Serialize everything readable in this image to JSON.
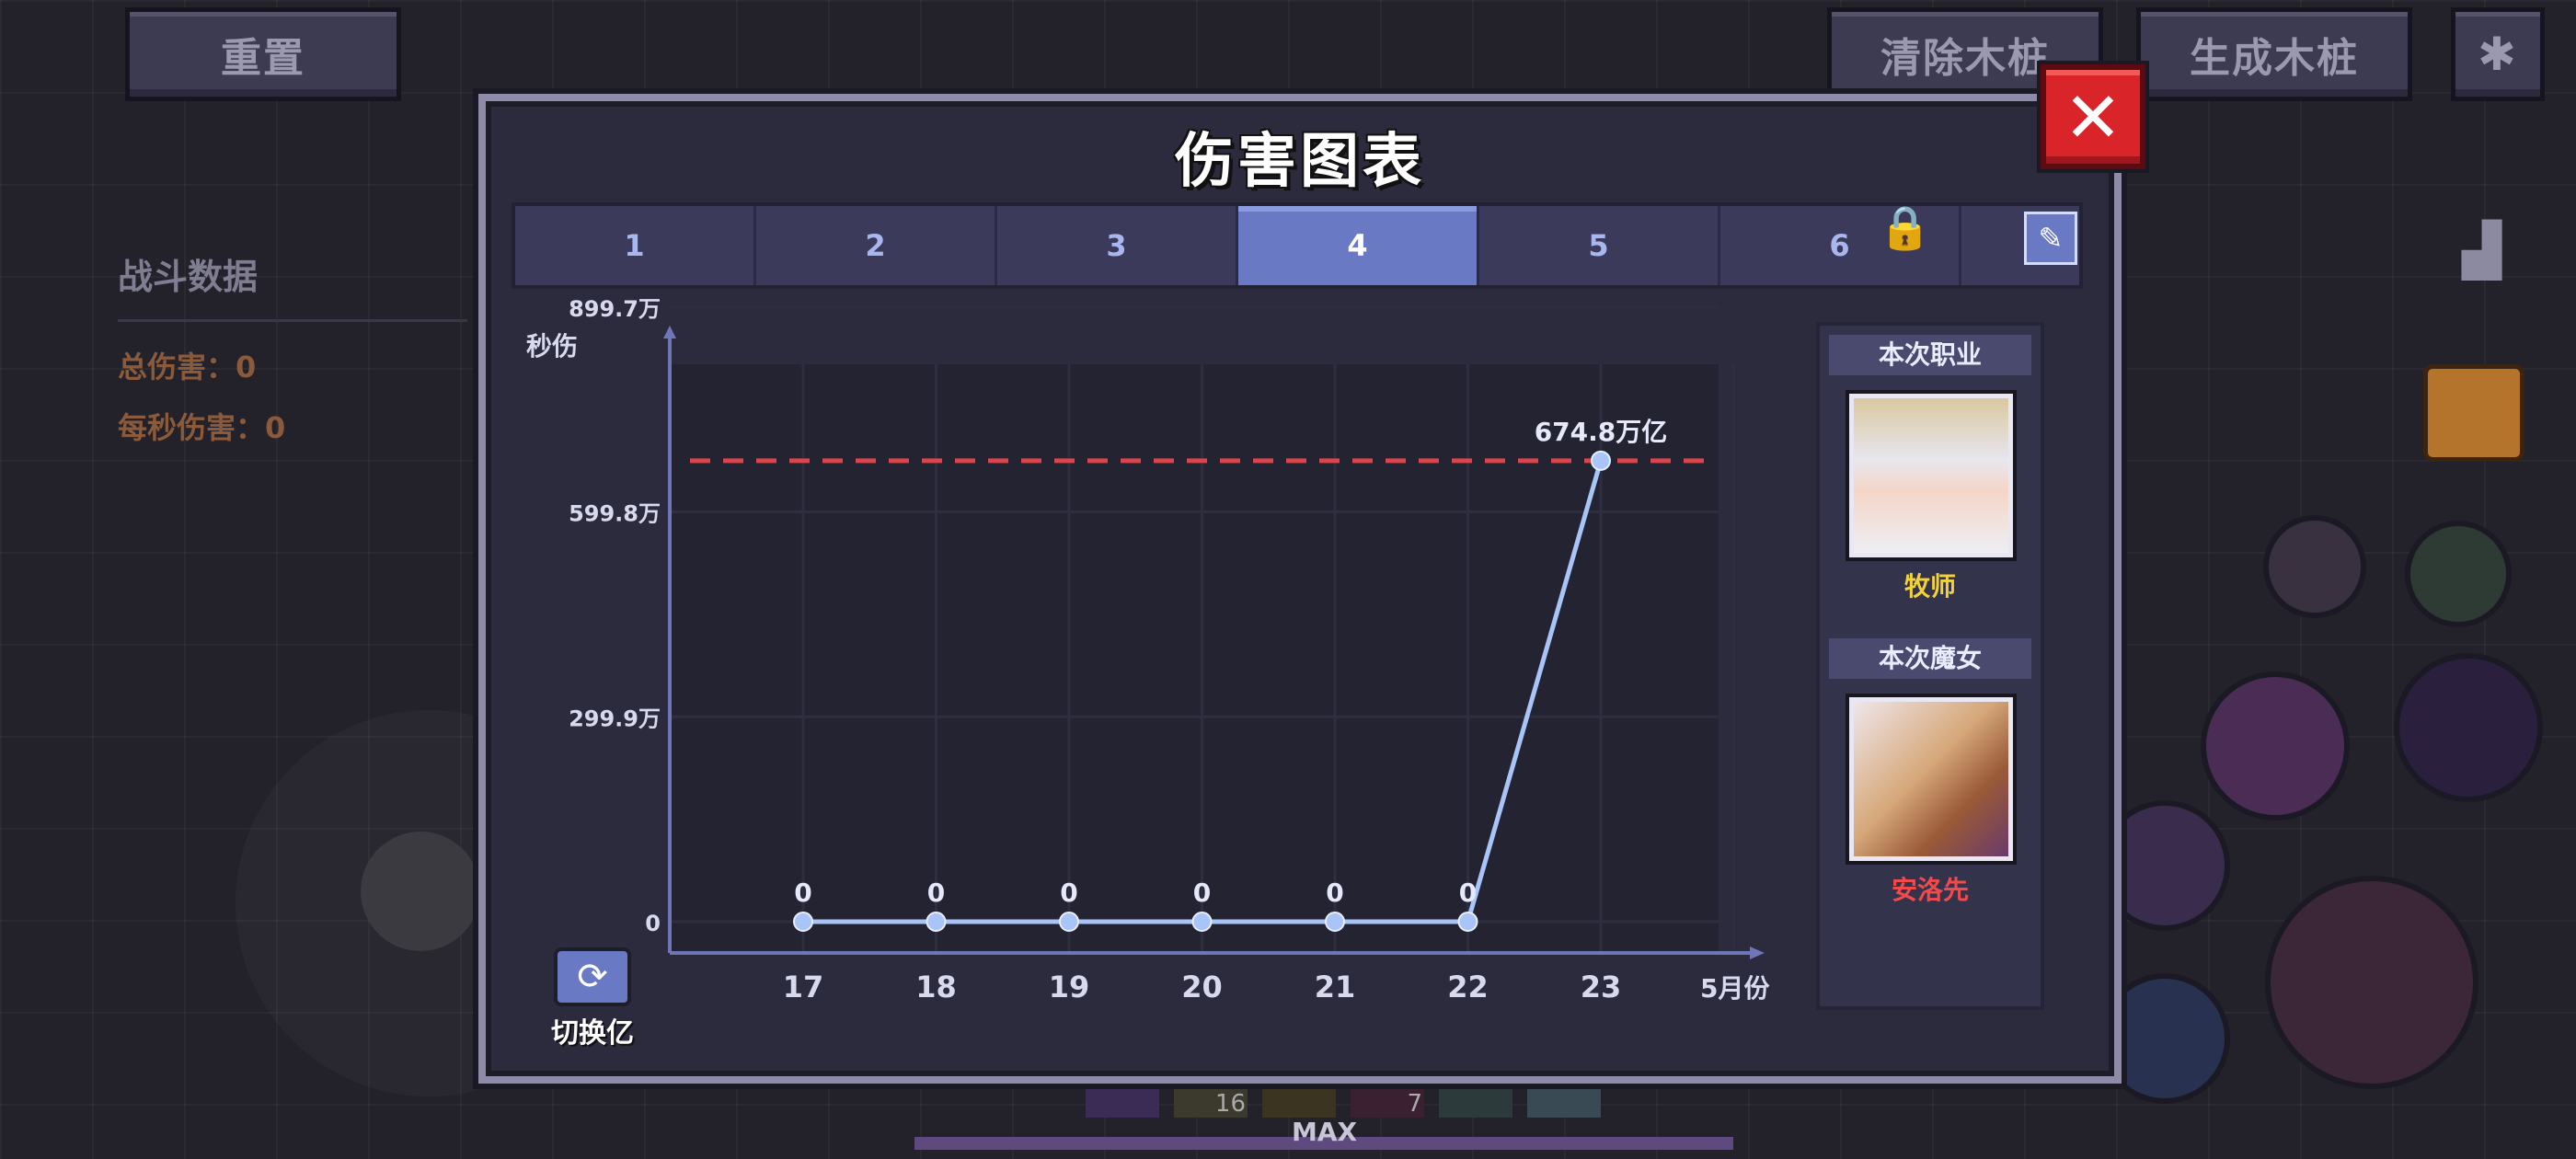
{
  "hud": {
    "reset_label": "重置",
    "clear_label": "清除木桩",
    "spawn_label": "生成木桩",
    "stats_title": "战斗数据",
    "total_damage": "总伤害：0",
    "dps": "每秒伤害：0",
    "max_label": "MAX",
    "slot_count_1": "16",
    "slot_count_2": "7"
  },
  "modal": {
    "title": "伤害图表",
    "close_symbol": "✕",
    "tabs": [
      {
        "label": "1",
        "active": false
      },
      {
        "label": "2",
        "active": false
      },
      {
        "label": "3",
        "active": false
      },
      {
        "label": "4",
        "active": true
      },
      {
        "label": "5",
        "active": false
      },
      {
        "label": "6",
        "active": false,
        "locked": true
      }
    ],
    "lock_icon": "lock-icon",
    "edit_icon": "pencil-icon",
    "switch_label": "切换亿",
    "class_label": "本次职业",
    "class_name": "牧师",
    "witch_label": "本次魔女",
    "witch_name": "安洛先",
    "colors": {
      "accent": "#6a79c4",
      "line": "#a9c4f7",
      "threshold": "#d9464c",
      "class_name": "#f2d23a",
      "witch_name": "#f24a4a"
    }
  },
  "chart_data": {
    "type": "line",
    "ylabel": "秒伤",
    "xlabel": "5月份",
    "categories": [
      "17",
      "18",
      "19",
      "20",
      "21",
      "22",
      "23"
    ],
    "series": [
      {
        "values": [
          0,
          0,
          0,
          0,
          0,
          0,
          674.8
        ]
      }
    ],
    "data_labels": [
      "0",
      "0",
      "0",
      "0",
      "0",
      "0",
      "674.8万亿"
    ],
    "y_ticks": [
      {
        "value": 0,
        "label": "0"
      },
      {
        "value": 299.9,
        "label": "299.9万"
      },
      {
        "value": 599.8,
        "label": "599.8万"
      },
      {
        "value": 899.7,
        "label": "899.7万"
      }
    ],
    "ylim": [
      0,
      960
    ],
    "threshold": 674.8,
    "grid": true
  }
}
